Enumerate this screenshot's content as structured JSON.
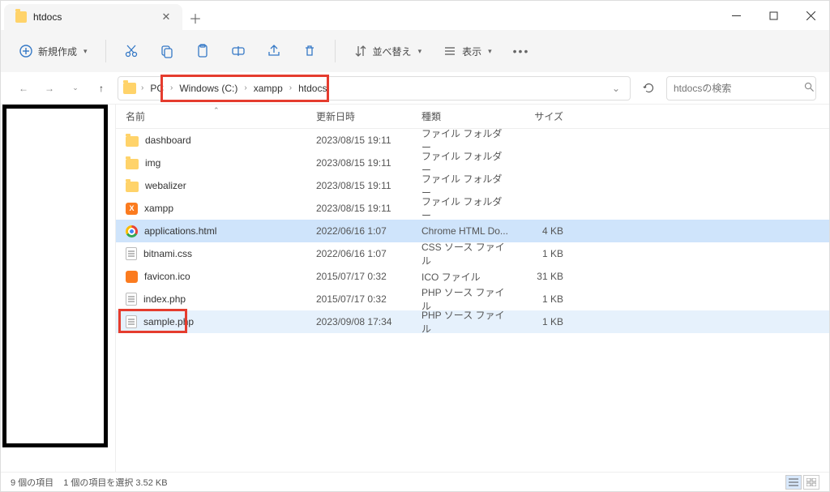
{
  "tab": {
    "title": "htdocs"
  },
  "toolbar": {
    "new_label": "新規作成",
    "sort_label": "並べ替え",
    "view_label": "表示"
  },
  "breadcrumb": {
    "items": [
      "PC",
      "Windows (C:)",
      "xampp",
      "htdocs"
    ]
  },
  "search": {
    "placeholder": "htdocsの検索"
  },
  "columns": {
    "name": "名前",
    "date": "更新日時",
    "type": "種類",
    "size": "サイズ"
  },
  "files": [
    {
      "name": "dashboard",
      "date": "2023/08/15 19:11",
      "type": "ファイル フォルダー",
      "size": "",
      "icon": "folder",
      "selected": false,
      "focus": false
    },
    {
      "name": "img",
      "date": "2023/08/15 19:11",
      "type": "ファイル フォルダー",
      "size": "",
      "icon": "folder",
      "selected": false,
      "focus": false
    },
    {
      "name": "webalizer",
      "date": "2023/08/15 19:11",
      "type": "ファイル フォルダー",
      "size": "",
      "icon": "folder",
      "selected": false,
      "focus": false
    },
    {
      "name": "xampp",
      "date": "2023/08/15 19:11",
      "type": "ファイル フォルダー",
      "size": "",
      "icon": "xampp",
      "selected": false,
      "focus": false
    },
    {
      "name": "applications.html",
      "date": "2022/06/16 1:07",
      "type": "Chrome HTML Do...",
      "size": "4 KB",
      "icon": "chrome",
      "selected": true,
      "focus": false
    },
    {
      "name": "bitnami.css",
      "date": "2022/06/16 1:07",
      "type": "CSS ソース ファイル",
      "size": "1 KB",
      "icon": "page",
      "selected": false,
      "focus": false
    },
    {
      "name": "favicon.ico",
      "date": "2015/07/17 0:32",
      "type": "ICO ファイル",
      "size": "31 KB",
      "icon": "ico",
      "selected": false,
      "focus": false
    },
    {
      "name": "index.php",
      "date": "2015/07/17 0:32",
      "type": "PHP ソース ファイル",
      "size": "1 KB",
      "icon": "page",
      "selected": false,
      "focus": false
    },
    {
      "name": "sample.php",
      "date": "2023/09/08 17:34",
      "type": "PHP ソース ファイル",
      "size": "1 KB",
      "icon": "page",
      "selected": false,
      "focus": true,
      "redbox": true
    }
  ],
  "status": {
    "count": "9 個の項目",
    "selected": "1 個の項目を選択 3.52 KB"
  },
  "redbox_crumbs_width": 208,
  "redbox_row_width": 85
}
